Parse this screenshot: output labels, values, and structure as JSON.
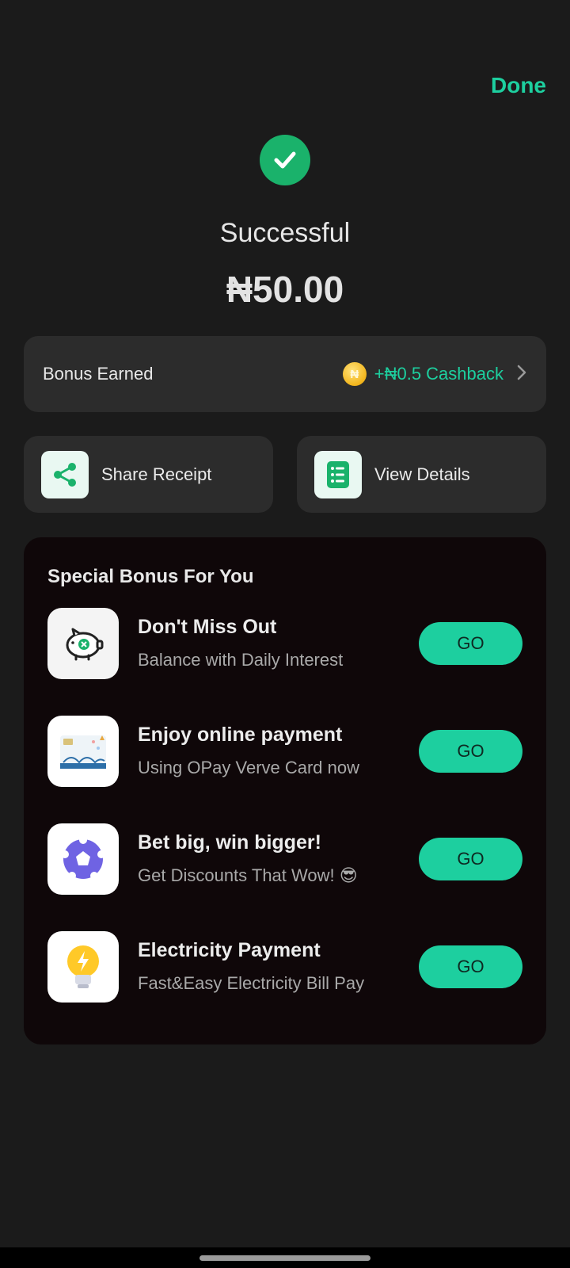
{
  "header": {
    "done_label": "Done"
  },
  "status": {
    "text": "Successful",
    "amount": "₦50.00"
  },
  "bonus": {
    "label": "Bonus Earned",
    "coin_symbol": "₦",
    "value": "+₦0.5 Cashback"
  },
  "actions": [
    {
      "label": "Share Receipt",
      "icon": "share-icon"
    },
    {
      "label": "View Details",
      "icon": "details-list-icon"
    }
  ],
  "special": {
    "title": "Special Bonus For You",
    "items": [
      {
        "title": "Don't Miss Out",
        "subtitle": "Balance with Daily Interest",
        "icon": "piggy-bank-icon",
        "button": "GO"
      },
      {
        "title": "Enjoy online payment",
        "subtitle": "Using OPay Verve Card now",
        "icon": "card-icon",
        "button": "GO"
      },
      {
        "title": "Bet big, win bigger!",
        "subtitle": "Get Discounts That Wow! 😎",
        "icon": "soccer-ball-icon",
        "button": "GO"
      },
      {
        "title": "Electricity Payment",
        "subtitle": "Fast&Easy Electricity Bill Pay",
        "icon": "light-bulb-icon",
        "button": "GO"
      }
    ]
  },
  "colors": {
    "accent": "#1dcf9f",
    "success": "#1ab26b",
    "background": "#1b1b1b",
    "card": "#2c2c2c",
    "panel": "#0f0709"
  }
}
